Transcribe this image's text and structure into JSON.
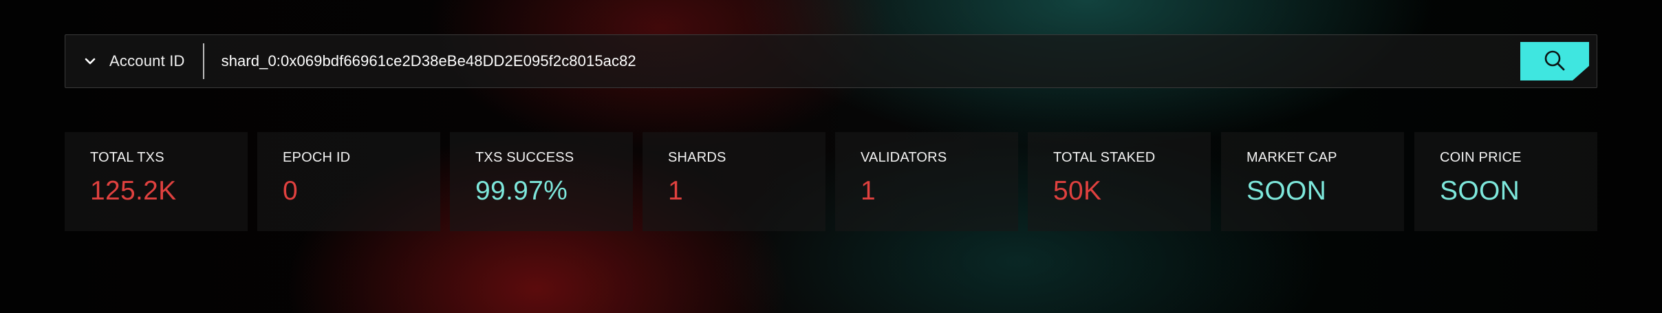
{
  "search": {
    "type_label": "Account ID",
    "value": "shard_0:0x069bdf66961ce2D38eBe48DD2E095f2c8015ac82",
    "button_icon": "search-icon"
  },
  "colors": {
    "accent_cyan": "#3fe6e0",
    "value_red": "#e0413f",
    "value_cyan": "#7ee8dc"
  },
  "stats": [
    {
      "label": "TOTAL TXS",
      "value": "125.2K",
      "color": "#e0413f"
    },
    {
      "label": "EPOCH ID",
      "value": "0",
      "color": "#e0413f"
    },
    {
      "label": "TXS SUCCESS",
      "value": "99.97%",
      "color": "#7ee8dc"
    },
    {
      "label": "SHARDS",
      "value": "1",
      "color": "#e0413f"
    },
    {
      "label": "VALIDATORS",
      "value": "1",
      "color": "#e0413f"
    },
    {
      "label": "TOTAL STAKED",
      "value": "50K",
      "color": "#e0413f"
    },
    {
      "label": "MARKET CAP",
      "value": "SOON",
      "color": "#7ee8dc"
    },
    {
      "label": "COIN PRICE",
      "value": "SOON",
      "color": "#7ee8dc"
    }
  ]
}
